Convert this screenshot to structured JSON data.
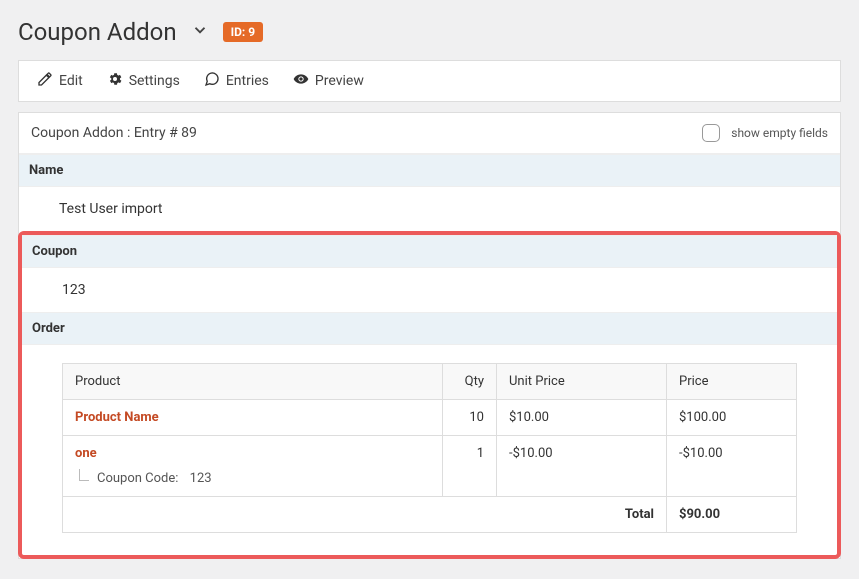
{
  "header": {
    "title": "Coupon Addon",
    "id_prefix": "ID:",
    "id_value": "9"
  },
  "toolbar": {
    "edit": "Edit",
    "settings": "Settings",
    "entries": "Entries",
    "preview": "Preview"
  },
  "entry": {
    "title": "Coupon Addon : Entry # 89",
    "show_empty_label": "show empty fields"
  },
  "sections": {
    "name": {
      "label": "Name",
      "value": "Test User import"
    },
    "coupon": {
      "label": "Coupon",
      "value": "123"
    },
    "order": {
      "label": "Order"
    }
  },
  "order_table": {
    "headers": {
      "product": "Product",
      "qty": "Qty",
      "unit": "Unit Price",
      "price": "Price"
    },
    "rows": [
      {
        "product": "Product Name",
        "qty": "10",
        "unit": "$10.00",
        "price": "$100.00",
        "coupon_code": null
      },
      {
        "product": "one",
        "qty": "1",
        "unit": "-$10.00",
        "price": "-$10.00",
        "coupon_code": "123"
      }
    ],
    "coupon_code_prefix": "Coupon Code:",
    "total_label": "Total",
    "total_value": "$90.00"
  }
}
